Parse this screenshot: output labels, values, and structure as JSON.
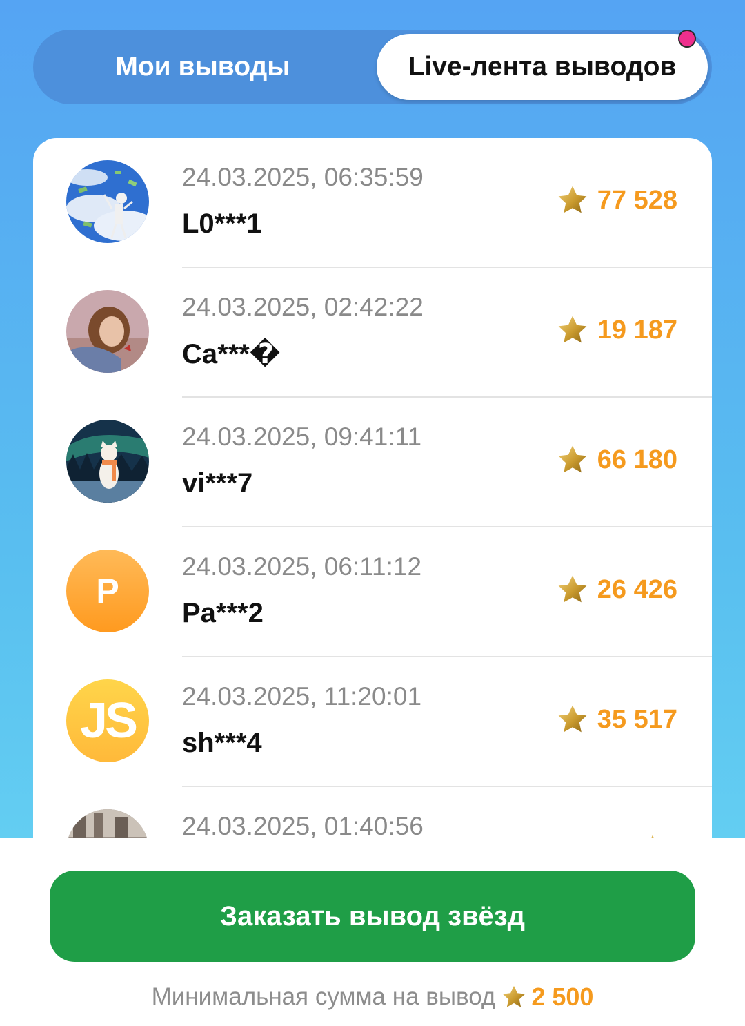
{
  "tabs": {
    "my_withdrawals": "Мои выводы",
    "live_feed": "Live-лента выводов",
    "active": "live_feed"
  },
  "feed": [
    {
      "date": "24.03.2025, 06:35:59",
      "name": "L0***1",
      "amount": "77 528",
      "avatar": "photo-skeleton-money"
    },
    {
      "date": "24.03.2025, 02:42:22",
      "name": "Ca***�",
      "amount": "19 187",
      "avatar": "photo-girl"
    },
    {
      "date": "24.03.2025, 09:41:11",
      "name": "vi***7",
      "amount": "66 180",
      "avatar": "photo-cat-aurora"
    },
    {
      "date": "24.03.2025, 06:11:12",
      "name": "Pa***2",
      "amount": "26 426",
      "avatar_letter": "P",
      "avatar_color": "#ffa22b"
    },
    {
      "date": "24.03.2025, 11:20:01",
      "name": "sh***4",
      "amount": "35 517",
      "avatar_letter": "JS",
      "avatar_color": "#ffc73a"
    },
    {
      "date": "24.03.2025, 01:40:56",
      "name": "",
      "amount": "",
      "avatar": "photo-street"
    }
  ],
  "order_button": {
    "label": "Заказать вывод звёзд"
  },
  "minimum": {
    "label": "Минимальная сумма на вывод",
    "amount": "2 500"
  },
  "colors": {
    "accent_orange": "#f59a1e",
    "button_green": "#1f9e47",
    "notification_dot": "#ee2f8d"
  },
  "icons": [
    "star-icon",
    "notification-dot"
  ]
}
